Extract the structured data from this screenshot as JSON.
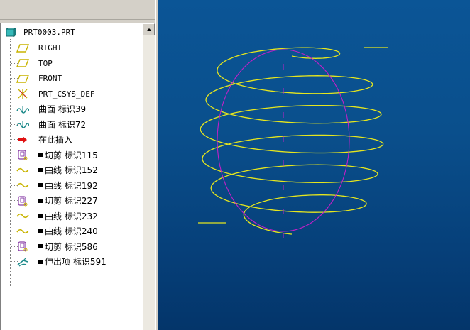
{
  "model_tree": {
    "root": {
      "label": "PRT0003.PRT",
      "icon": "part-cube-icon"
    },
    "items": [
      {
        "label": "RIGHT",
        "icon": "datum-plane-icon",
        "bullet": false
      },
      {
        "label": "TOP",
        "icon": "datum-plane-icon",
        "bullet": false
      },
      {
        "label": "FRONT",
        "icon": "datum-plane-icon",
        "bullet": false
      },
      {
        "label": "PRT_CSYS_DEF",
        "icon": "coordinate-system-icon",
        "bullet": false
      },
      {
        "label": "曲面 标识39",
        "icon": "surface-icon",
        "bullet": false
      },
      {
        "label": "曲面 标识72",
        "icon": "surface-icon",
        "bullet": false
      },
      {
        "label": "在此插入",
        "icon": "insert-here-arrow-icon",
        "bullet": false
      },
      {
        "label": "切剪 标识115",
        "icon": "cut-icon",
        "bullet": true
      },
      {
        "label": "曲线 标识152",
        "icon": "curve-icon",
        "bullet": true
      },
      {
        "label": "曲线 标识192",
        "icon": "curve-icon",
        "bullet": true
      },
      {
        "label": "切剪 标识227",
        "icon": "cut-icon",
        "bullet": true
      },
      {
        "label": "曲线 标识232",
        "icon": "curve-icon",
        "bullet": true
      },
      {
        "label": "曲线 标识240",
        "icon": "curve-icon",
        "bullet": true
      },
      {
        "label": "切剪 标识586",
        "icon": "cut-icon",
        "bullet": true
      },
      {
        "label": "伸出项 标识591",
        "icon": "protrusion-icon",
        "bullet": true
      }
    ]
  },
  "viewport": {
    "background_top": "#0b5596",
    "background_bottom": "#04356a",
    "spring_color": "#e6e61e",
    "profile_color": "#c020c8",
    "coils": 6
  }
}
